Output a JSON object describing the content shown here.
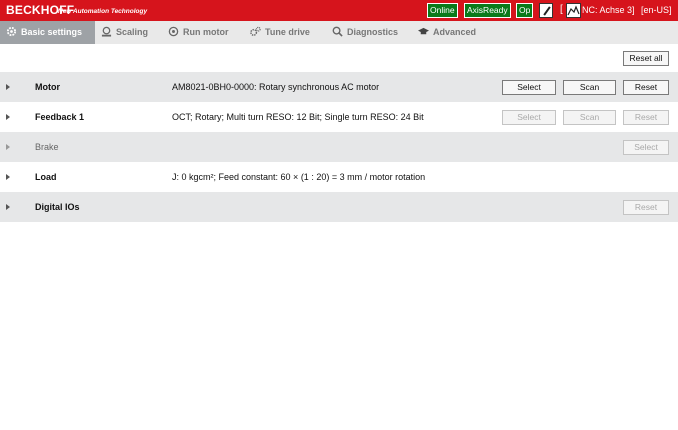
{
  "header": {
    "brand": "BECKHOFF",
    "tagline": "New Automation Technology",
    "status_online": "Online",
    "status_axis": "AxisReady",
    "status_op": "Op",
    "bracket": "[",
    "axis_name": "NC: Achse 3]",
    "language": "[en-US]",
    "status_color": "#0a7a1a",
    "brand_color": "#d6141c"
  },
  "tabs": [
    {
      "label": "Basic settings",
      "icon": "gear-icon",
      "active": true
    },
    {
      "label": "Scaling",
      "icon": "scale-icon",
      "active": false
    },
    {
      "label": "Run motor",
      "icon": "motor-icon",
      "active": false
    },
    {
      "label": "Tune drive",
      "icon": "gears-icon",
      "active": false
    },
    {
      "label": "Diagnostics",
      "icon": "magnifier-icon",
      "active": false
    },
    {
      "label": "Advanced",
      "icon": "graduation-cap-icon",
      "active": false
    }
  ],
  "toolbar": {
    "reset_all": "Reset all"
  },
  "rows": [
    {
      "label": "Motor",
      "description": "AM8021-0BH0-0000: Rotary synchronous AC motor",
      "select": "Select",
      "scan": "Scan",
      "reset": "Reset"
    },
    {
      "label": "Feedback 1",
      "description": "OCT; Rotary; Multi turn RESO: 12 Bit; Single turn RESO: 24 Bit",
      "select": "Select",
      "scan": "Scan",
      "reset": "Reset"
    },
    {
      "label": "Brake",
      "select": "Select"
    },
    {
      "label": "Load",
      "description": "J: 0 kgcm²; Feed constant: 60 × (1 : 20)  = 3 mm / motor rotation"
    },
    {
      "label": "Digital IOs",
      "reset": "Reset"
    }
  ]
}
